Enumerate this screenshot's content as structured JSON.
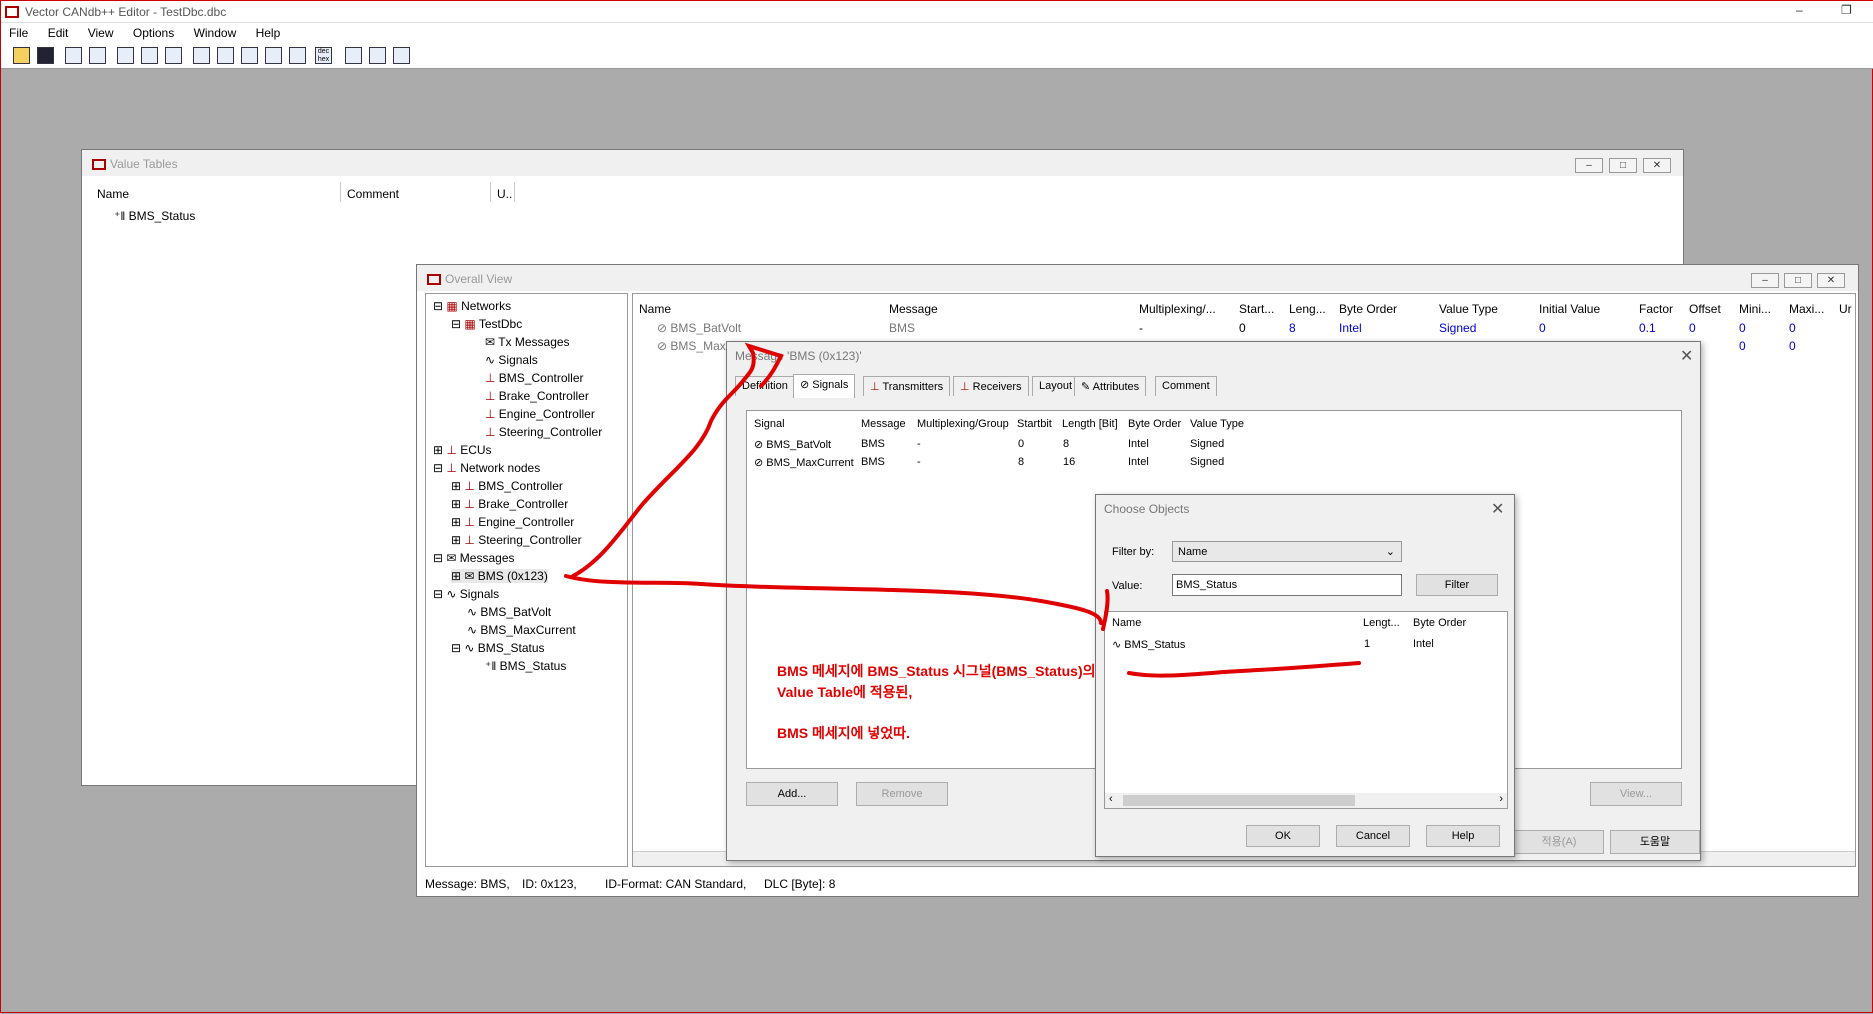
{
  "app": {
    "title": "Vector CANdb++ Editor - TestDbc.dbc"
  },
  "menu": [
    "File",
    "Edit",
    "View",
    "Options",
    "Window",
    "Help"
  ],
  "value_tables": {
    "title": "Value Tables",
    "columns": [
      "Name",
      "Comment",
      "U.."
    ],
    "rows": [
      "BMS_Status"
    ]
  },
  "overall": {
    "title": "Overall View",
    "tree": [
      {
        "label": "Networks",
        "level": 0
      },
      {
        "label": "TestDbc",
        "level": 1
      },
      {
        "label": "Tx Messages",
        "level": 2
      },
      {
        "label": "Signals",
        "level": 2
      },
      {
        "label": "BMS_Controller",
        "level": 2
      },
      {
        "label": "Brake_Controller",
        "level": 2
      },
      {
        "label": "Engine_Controller",
        "level": 2
      },
      {
        "label": "Steering_Controller",
        "level": 2
      },
      {
        "label": "ECUs",
        "level": 0
      },
      {
        "label": "Network nodes",
        "level": 0
      },
      {
        "label": "BMS_Controller",
        "level": 1
      },
      {
        "label": "Brake_Controller",
        "level": 1
      },
      {
        "label": "Engine_Controller",
        "level": 1
      },
      {
        "label": "Steering_Controller",
        "level": 1
      },
      {
        "label": "Messages",
        "level": 0
      },
      {
        "label": "BMS (0x123)",
        "level": 1
      },
      {
        "label": "Signals",
        "level": 0
      },
      {
        "label": "BMS_BatVolt",
        "level": 1
      },
      {
        "label": "BMS_MaxCurrent",
        "level": 1
      },
      {
        "label": "BMS_Status",
        "level": 1
      },
      {
        "label": "BMS_Status",
        "level": 2
      }
    ],
    "columns": [
      "Name",
      "Message",
      "Multiplexing/...",
      "Start...",
      "Leng...",
      "Byte Order",
      "Value Type",
      "Initial Value",
      "Factor",
      "Offset",
      "Mini...",
      "Maxi...",
      "Ur"
    ],
    "row1": {
      "name": "BMS_BatVolt",
      "message": "BMS",
      "mux": "-",
      "start": "0",
      "length": "8",
      "order": "Intel",
      "vtype": "Signed",
      "init": "0",
      "factor": "0.1",
      "offset": "0",
      "min": "0",
      "max": "0"
    },
    "row2": {
      "name": "BMS_Max",
      "min": "0",
      "max": "0"
    },
    "status": {
      "message": "Message: BMS,",
      "id": "ID: 0x123,",
      "format": "ID-Format: CAN Standard,",
      "dlc": "DLC [Byte]: 8"
    }
  },
  "msg_dialog": {
    "title": "Message 'BMS (0x123)'",
    "tabs": [
      "Definition",
      "Signals",
      "Transmitters",
      "Receivers",
      "Layout",
      "Attributes",
      "Comment"
    ],
    "columns": [
      "Signal",
      "Message",
      "Multiplexing/Group",
      "Startbit",
      "Length [Bit]",
      "Byte Order",
      "Value Type"
    ],
    "rows": [
      [
        "BMS_BatVolt",
        "BMS",
        "-",
        "0",
        "8",
        "Intel",
        "Signed"
      ],
      [
        "BMS_MaxCurrent",
        "BMS",
        "-",
        "8",
        "16",
        "Intel",
        "Signed"
      ]
    ],
    "buttons": {
      "add": "Add...",
      "remove": "Remove",
      "view": "View...",
      "apply": "적용(A)",
      "help": "도움말"
    }
  },
  "choose_dialog": {
    "title": "Choose Objects",
    "filter_label": "Filter by:",
    "filter_value": "Name",
    "value_label": "Value:",
    "value_text": "BMS_Status",
    "filter_button": "Filter",
    "columns": [
      "Name",
      "Lengt...",
      "Byte Order"
    ],
    "row": [
      "BMS_Status",
      "1",
      "Intel"
    ],
    "buttons": {
      "ok": "OK",
      "cancel": "Cancel",
      "help": "Help"
    }
  },
  "annotation": {
    "line1": "BMS 메세지에 BMS_Status 시그널(BMS_Status)의",
    "line2": "Value Table에 적용된,",
    "line3": "BMS 메세지에 넣었따."
  },
  "colors": {
    "ink": "#e00000",
    "blue_text": "#0000cc"
  }
}
